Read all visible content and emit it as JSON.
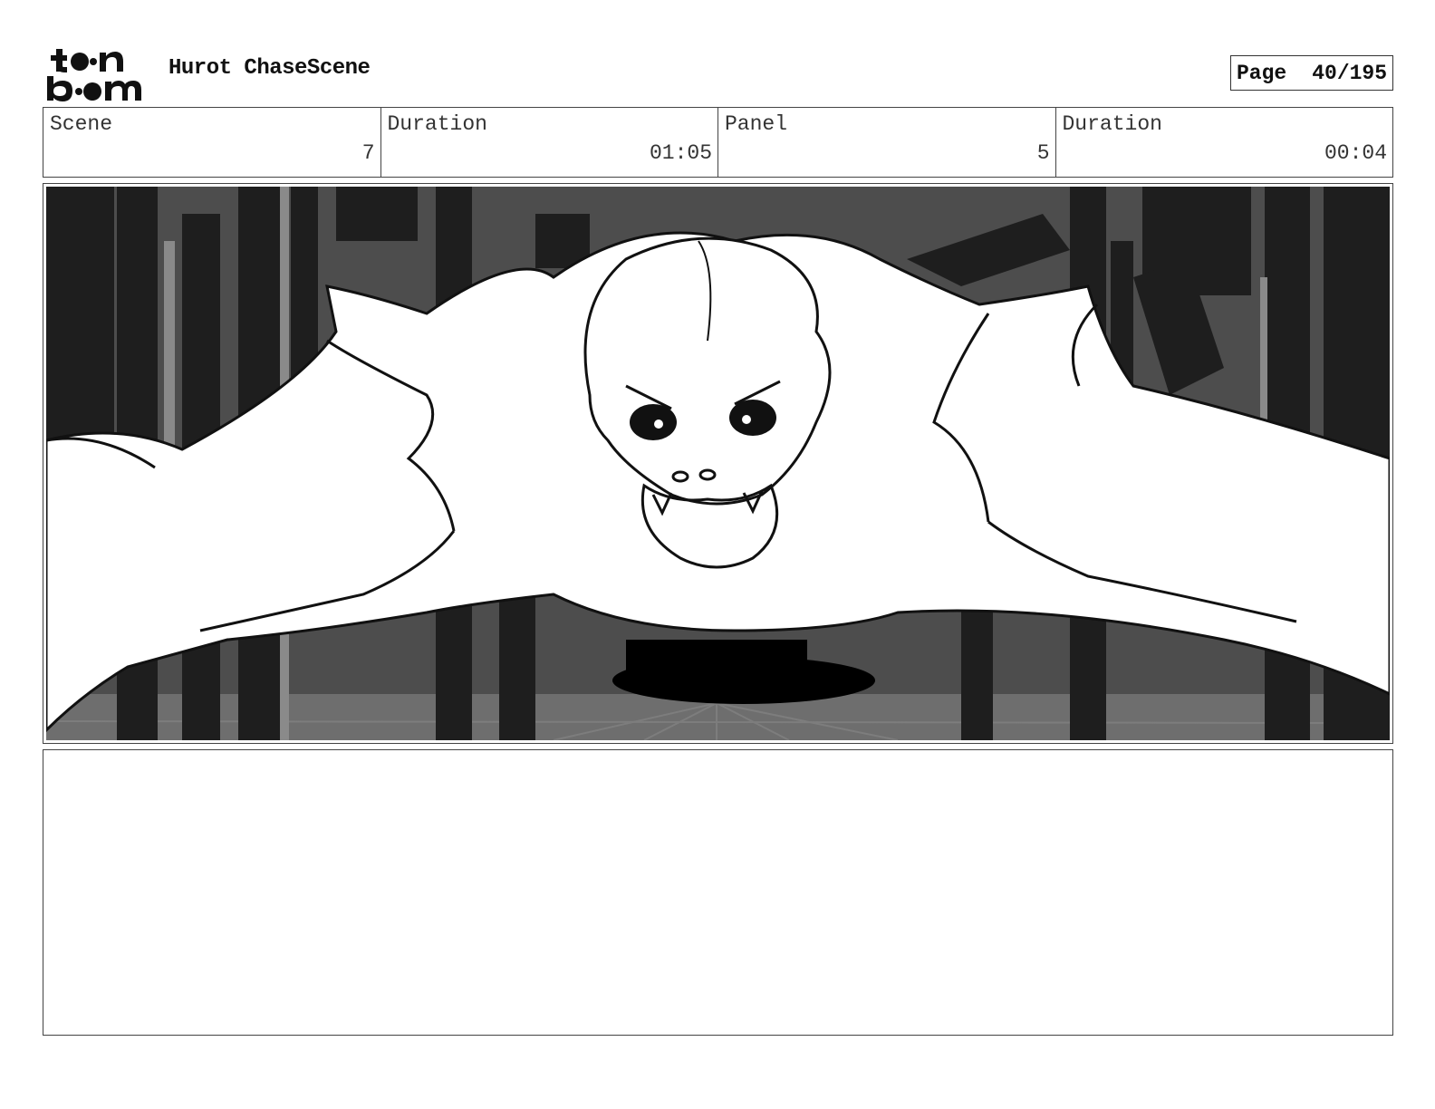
{
  "header": {
    "logo_text": "toon boom",
    "project_title": "Hurot ChaseScene",
    "page_label": "Page",
    "page_value": "40/195"
  },
  "info": {
    "scene_label": "Scene",
    "scene_value": "7",
    "scene_duration_label": "Duration",
    "scene_duration_value": "01:05",
    "panel_label": "Panel",
    "panel_value": "5",
    "panel_duration_label": "Duration",
    "panel_duration_value": "00:04"
  },
  "panel_image": {
    "description_icon": "storyboard-sketch-creature-icon"
  },
  "notes": {
    "text": ""
  }
}
